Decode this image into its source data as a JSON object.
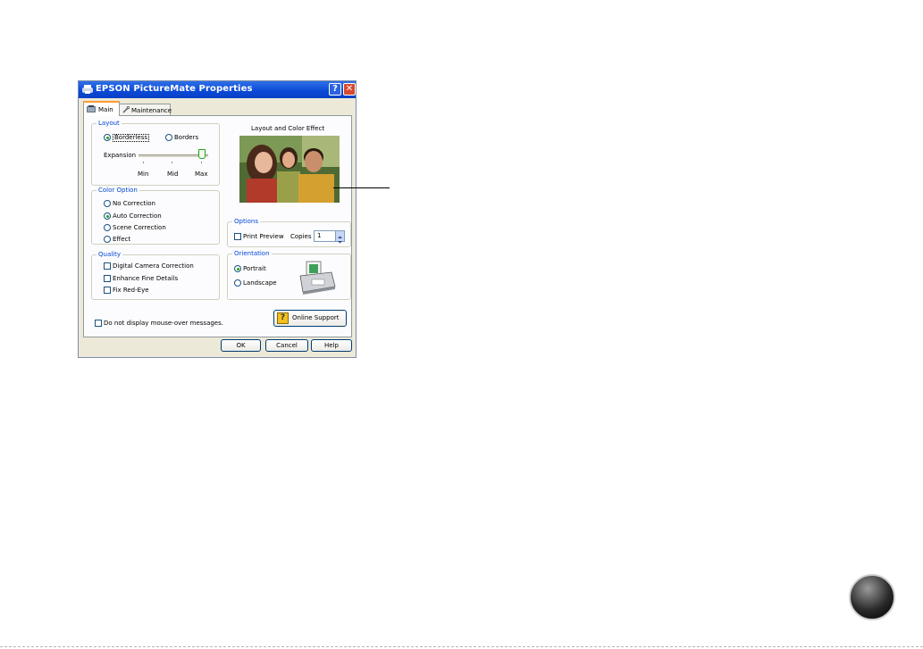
{
  "window": {
    "title": "EPSON PictureMate Properties",
    "help_glyph": "?",
    "close_glyph": "✕"
  },
  "tabs": [
    {
      "label": "Main"
    },
    {
      "label": "Maintenance"
    }
  ],
  "layout_group": {
    "title": "Layout",
    "borderless": "Borderless",
    "borders": "Borders",
    "expansion_label": "Expansion",
    "expansion_level": "max",
    "ticks": [
      "Min",
      "Mid",
      "Max"
    ]
  },
  "color_option": {
    "title": "Color Option",
    "options": [
      "No Correction",
      "Auto Correction",
      "Scene Correction",
      "Effect"
    ],
    "selected": "Auto Correction"
  },
  "quality": {
    "title": "Quality",
    "options": [
      "Digital Camera Correction",
      "Enhance Fine Details",
      "Fix Red-Eye"
    ]
  },
  "preview": {
    "title": "Layout and Color Effect"
  },
  "options_group": {
    "title": "Options",
    "print_preview": "Print Preview",
    "copies_label": "Copies",
    "copies_value": "1"
  },
  "orientation": {
    "title": "Orientation",
    "portrait": "Portrait",
    "landscape": "Landscape",
    "selected": "Portrait"
  },
  "online_support": "Online Support",
  "mouse_over_checkbox": "Do not display mouse-over messages.",
  "buttons": {
    "ok": "OK",
    "cancel": "Cancel",
    "help": "Help"
  },
  "colors": {
    "titlebar": "#0a49d6",
    "group_title": "#0046d5",
    "dialog_bg": "#ece9d8",
    "radio_dot": "#21a121"
  }
}
